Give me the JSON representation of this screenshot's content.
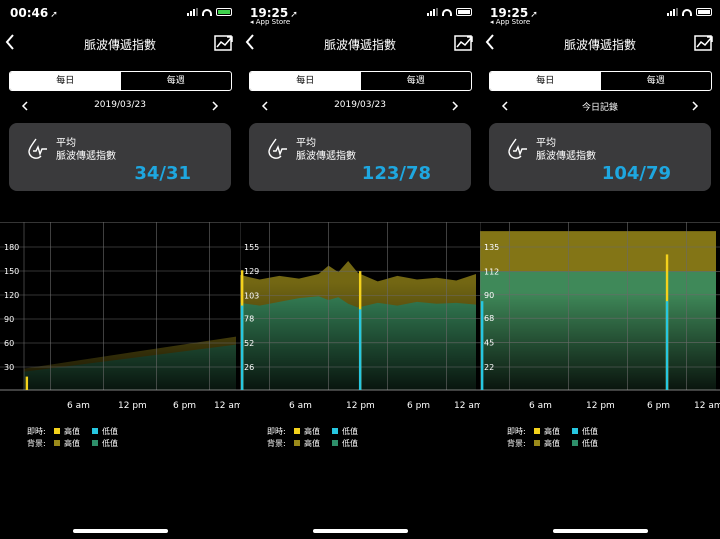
{
  "colors": {
    "instant_high": "#f4d21c",
    "instant_low": "#27c7e0",
    "bg_high": "#9a8a1a",
    "bg_low": "#2e8f6a",
    "value_blue": "#1ea7e0",
    "card_bg": "#3a3a3c"
  },
  "icons": {
    "back": "chevron-left-icon",
    "chart_toggle": "line-chart-icon",
    "pulse": "pulse-drop-icon",
    "prev": "chevron-left-icon",
    "next": "chevron-right-icon"
  },
  "screens": [
    {
      "status_time": "00:46",
      "back_app": "",
      "title": "脈波傳遞指數",
      "tabs": [
        "每日",
        "每週"
      ],
      "selected_tab": 0,
      "date": "2019/03/23",
      "card": {
        "line1": "平均",
        "line2": "脈波傳遞指數",
        "value": "34/31"
      },
      "legend": {
        "row1_label": "即時:",
        "row2_label": "背景:",
        "high": "高值",
        "low": "低值"
      },
      "chart_data": {
        "type": "area",
        "y_ticks": [
          "180",
          "150",
          "120",
          "90",
          "60",
          "30"
        ],
        "ylim": [
          0,
          180
        ],
        "x_ticks": [
          "6 am",
          "12 pm",
          "6 pm",
          "12 am"
        ],
        "xlim_hours": [
          0,
          24
        ],
        "background_high": {
          "x": [
            0,
            24
          ],
          "y": [
            28,
            68
          ]
        },
        "background_low": {
          "x": [
            0,
            24
          ],
          "y": [
            24,
            58
          ]
        },
        "instant_high": [
          {
            "x": 0.3,
            "y": 18
          }
        ],
        "instant_low": []
      }
    },
    {
      "status_time": "19:25",
      "back_app": "◂ App Store",
      "title": "脈波傳遞指數",
      "tabs": [
        "每日",
        "每週"
      ],
      "selected_tab": 0,
      "date": "2019/03/23",
      "card": {
        "line1": "平均",
        "line2": "脈波傳遞指數",
        "value": "123/78"
      },
      "legend": {
        "row1_label": "即時:",
        "row2_label": "背景:",
        "high": "高值",
        "low": "低值"
      },
      "chart_data": {
        "type": "area",
        "y_ticks": [
          "155",
          "129",
          "103",
          "78",
          "52",
          "26"
        ],
        "ylim": [
          0,
          155
        ],
        "x_ticks": [
          "6 am",
          "12 pm",
          "6 pm",
          "12 am"
        ],
        "xlim_hours": [
          0,
          24
        ],
        "background_high": {
          "x": [
            0,
            2,
            4,
            6,
            8,
            9,
            10,
            11,
            12,
            14,
            16,
            18,
            20,
            22,
            24
          ],
          "y": [
            125,
            120,
            124,
            121,
            126,
            135,
            128,
            140,
            127,
            118,
            124,
            120,
            122,
            119,
            126
          ]
        },
        "background_low": {
          "x": [
            0,
            2,
            4,
            6,
            8,
            9,
            10,
            11,
            12,
            14,
            16,
            18,
            20,
            22,
            24
          ],
          "y": [
            95,
            92,
            96,
            100,
            102,
            98,
            101,
            94,
            90,
            95,
            92,
            96,
            94,
            95,
            93
          ]
        },
        "instant_high": [
          {
            "x": 0.2,
            "y": 130
          },
          {
            "x": 12.2,
            "y": 129
          }
        ],
        "instant_low": [
          {
            "x": 0.2,
            "y": 92
          },
          {
            "x": 12.2,
            "y": 88
          }
        ]
      }
    },
    {
      "status_time": "19:25",
      "back_app": "◂ App Store",
      "title": "脈波傳遞指數",
      "tabs": [
        "每日",
        "每週"
      ],
      "selected_tab": 0,
      "date": "今日記錄",
      "card": {
        "line1": "平均",
        "line2": "脈波傳遞指數",
        "value": "104/79"
      },
      "legend": {
        "row1_label": "即時:",
        "row2_label": "背景:",
        "high": "高值",
        "low": "低值"
      },
      "chart_data": {
        "type": "area",
        "y_ticks": [
          "135",
          "112",
          "90",
          "68",
          "45",
          "22"
        ],
        "ylim": [
          0,
          135
        ],
        "x_ticks": [
          "6 am",
          "12 pm",
          "6 pm",
          "12 am"
        ],
        "xlim_hours": [
          0,
          24
        ],
        "background_high": {
          "x": [
            0,
            24
          ],
          "y": [
            150,
            150
          ]
        },
        "background_low": {
          "x": [
            0,
            24
          ],
          "y": [
            112,
            112
          ]
        },
        "instant_high": [
          {
            "x": 19.0,
            "y": 128
          }
        ],
        "instant_low": [
          {
            "x": 0.2,
            "y": 84
          },
          {
            "x": 19.0,
            "y": 84
          }
        ]
      }
    }
  ]
}
